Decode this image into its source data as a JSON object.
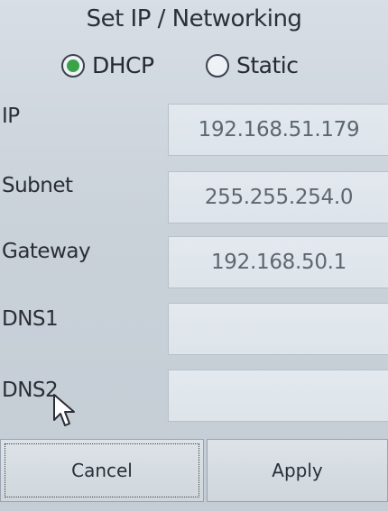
{
  "title": "Set IP / Networking",
  "mode": {
    "options": [
      {
        "label": "DHCP",
        "selected": true
      },
      {
        "label": "Static",
        "selected": false
      }
    ]
  },
  "fields": {
    "ip": {
      "label": "IP",
      "value": "192.168.51.179"
    },
    "subnet": {
      "label": "Subnet",
      "value": "255.255.254.0"
    },
    "gateway": {
      "label": "Gateway",
      "value": "192.168.50.1"
    },
    "dns1": {
      "label": "DNS1",
      "value": ""
    },
    "dns2": {
      "label": "DNS2",
      "value": ""
    }
  },
  "buttons": {
    "cancel": "Cancel",
    "apply": "Apply"
  },
  "colors": {
    "radio_selected": "#39a34a"
  },
  "icons": {
    "pointer": "arrow-cursor-icon"
  }
}
